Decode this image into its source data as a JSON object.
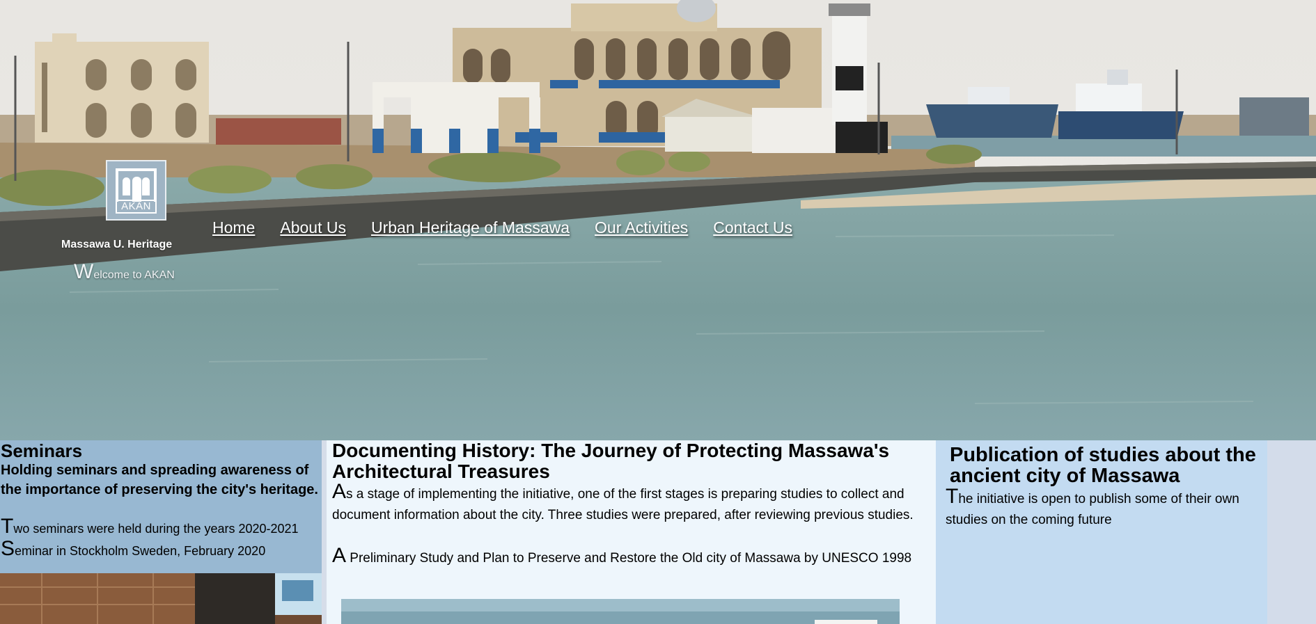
{
  "site": {
    "logo_text": "AKAN",
    "brand": "Massawa U. Heritage",
    "welcome_first": "W",
    "welcome_rest": "elcome to AKAN"
  },
  "nav": {
    "items": [
      {
        "label": "Home"
      },
      {
        "label": "About Us"
      },
      {
        "label": "Urban Heritage of Massawa"
      },
      {
        "label": "Our Activities"
      },
      {
        "label": "Contact Us"
      }
    ]
  },
  "seminars": {
    "title": "Seminars",
    "lead": "Holding seminars and spreading awareness of the importance of preserving the city's heritage.",
    "p1_first": "T",
    "p1_rest": "wo seminars were held during the years 2020-2021",
    "p2_first": "S",
    "p2_rest": "eminar in Stockholm Sweden, February 2020"
  },
  "documenting": {
    "title": "Documenting History: The Journey of Protecting Massawa's Architectural Treasures",
    "p1_first": "A",
    "p1_rest": "s a stage of implementing the initiative, one of the first stages is preparing studies to collect and document information about the city. Three studies were prepared, after reviewing previous studies.",
    "p2_first": "A",
    "p2_rest": " Preliminary Study and Plan to Preserve and Restore the Old city of Massawa by UNESCO 1998"
  },
  "publication": {
    "title": "Publication of studies about the ancient city of Massawa",
    "p1_first": "T",
    "p1_rest": "he initiative is open to publish some of their own studies on the coming future"
  },
  "colors": {
    "seminars_bg": "#98b8d2",
    "documenting_bg": "#eef6fc",
    "publication_bg": "#c3dbf1",
    "sea": "#7e9ea0",
    "sky": "#e9e7e4"
  }
}
